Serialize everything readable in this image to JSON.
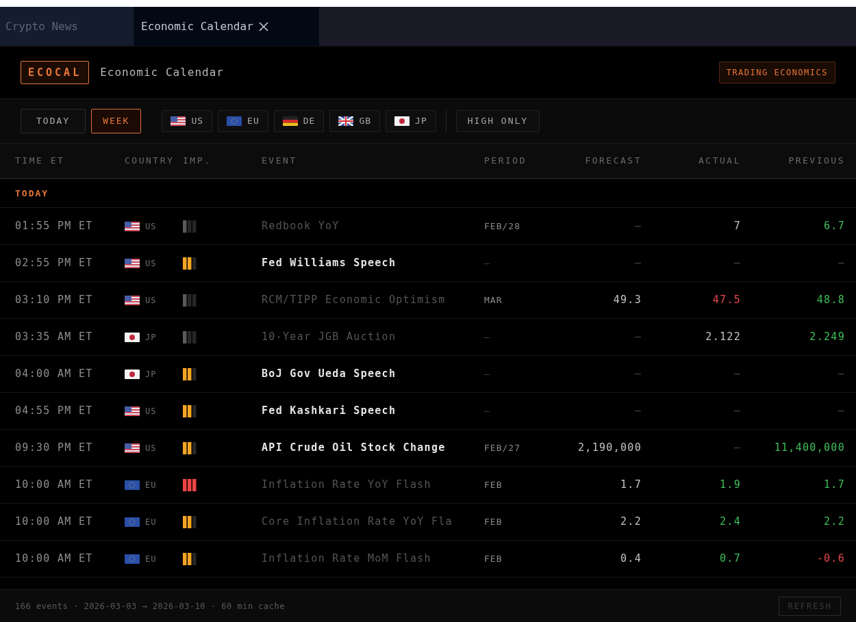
{
  "tabs": [
    {
      "label": "Crypto News",
      "selected": false
    },
    {
      "label": "Economic Calendar",
      "selected": true
    }
  ],
  "header": {
    "badge": "ECOCAL",
    "title": "Economic Calendar",
    "source": "TRADING ECONOMICS"
  },
  "range_buttons": [
    {
      "label": "TODAY",
      "selected": false
    },
    {
      "label": "WEEK",
      "selected": true
    }
  ],
  "country_filters": [
    {
      "kind": "us",
      "label": "US",
      "selected": false
    },
    {
      "kind": "eu",
      "label": "EU",
      "selected": false
    },
    {
      "kind": "de",
      "label": "DE",
      "selected": false
    },
    {
      "kind": "gb",
      "label": "GB",
      "selected": false
    },
    {
      "kind": "jp",
      "label": "JP",
      "selected": false
    }
  ],
  "high_only": {
    "label": "HIGH ONLY",
    "on": false
  },
  "columns": [
    "TIME ET",
    "COUNTRY",
    "IMP.",
    "EVENT",
    "PERIOD",
    "FORECAST",
    "ACTUAL",
    "PREVIOUS"
  ],
  "section": "TODAY",
  "rows": [
    {
      "time": "01:55 PM ET",
      "kind": "us",
      "country": "US",
      "importance": {
        "kind": "low"
      },
      "event": "Redbook YoY",
      "released": true,
      "period": {
        "text": "FEB/28",
        "color": "#8a8a8a"
      },
      "forecast": {
        "text": "—",
        "color": "#4a4a4a"
      },
      "actual": {
        "text": "7",
        "color": "#c4c4c4"
      },
      "previous": {
        "text": "6.7",
        "color": "#3fbf5a"
      }
    },
    {
      "time": "02:55 PM ET",
      "kind": "us",
      "country": "US",
      "importance": {
        "kind": "medium"
      },
      "event": "Fed Williams Speech",
      "released": false,
      "period": {
        "text": "—",
        "color": "#4a4a4a"
      },
      "forecast": {
        "text": "—",
        "color": "#4a4a4a"
      },
      "actual": {
        "text": "—",
        "color": "#4a4a4a"
      },
      "previous": {
        "text": "—",
        "color": "#4a4a4a"
      }
    },
    {
      "time": "03:10 PM ET",
      "kind": "us",
      "country": "US",
      "importance": {
        "kind": "low"
      },
      "event": "RCM/TIPP Economic Optimism",
      "released": true,
      "period": {
        "text": "MAR",
        "color": "#8a8a8a"
      },
      "forecast": {
        "text": "49.3",
        "color": "#c4c4c4"
      },
      "actual": {
        "text": "47.5",
        "color": "#e5484d"
      },
      "previous": {
        "text": "48.8",
        "color": "#3fbf5a"
      }
    },
    {
      "time": "03:35 AM ET",
      "kind": "jp",
      "country": "JP",
      "importance": {
        "kind": "low"
      },
      "event": "10-Year JGB Auction",
      "released": true,
      "period": {
        "text": "—",
        "color": "#4a4a4a"
      },
      "forecast": {
        "text": "—",
        "color": "#4a4a4a"
      },
      "actual": {
        "text": "2.122",
        "color": "#c4c4c4"
      },
      "previous": {
        "text": "2.249",
        "color": "#3fbf5a"
      }
    },
    {
      "time": "04:00 AM ET",
      "kind": "jp",
      "country": "JP",
      "importance": {
        "kind": "medium"
      },
      "event": "BoJ Gov Ueda Speech",
      "released": false,
      "period": {
        "text": "—",
        "color": "#4a4a4a"
      },
      "forecast": {
        "text": "—",
        "color": "#4a4a4a"
      },
      "actual": {
        "text": "—",
        "color": "#4a4a4a"
      },
      "previous": {
        "text": "—",
        "color": "#4a4a4a"
      }
    },
    {
      "time": "04:55 PM ET",
      "kind": "us",
      "country": "US",
      "importance": {
        "kind": "medium"
      },
      "event": "Fed Kashkari Speech",
      "released": false,
      "period": {
        "text": "—",
        "color": "#4a4a4a"
      },
      "forecast": {
        "text": "—",
        "color": "#4a4a4a"
      },
      "actual": {
        "text": "—",
        "color": "#4a4a4a"
      },
      "previous": {
        "text": "—",
        "color": "#4a4a4a"
      }
    },
    {
      "time": "09:30 PM ET",
      "kind": "us",
      "country": "US",
      "importance": {
        "kind": "medium"
      },
      "event": "API Crude Oil Stock Change",
      "released": false,
      "period": {
        "text": "FEB/27",
        "color": "#8a8a8a"
      },
      "forecast": {
        "text": "2,190,000",
        "color": "#c4c4c4"
      },
      "actual": {
        "text": "—",
        "color": "#4a4a4a"
      },
      "previous": {
        "text": "11,400,000",
        "color": "#3fbf5a"
      }
    },
    {
      "time": "10:00 AM ET",
      "kind": "eu",
      "country": "EU",
      "importance": {
        "kind": "high"
      },
      "event": "Inflation Rate YoY Flash",
      "released": true,
      "period": {
        "text": "FEB",
        "color": "#8a8a8a"
      },
      "forecast": {
        "text": "1.7",
        "color": "#c4c4c4"
      },
      "actual": {
        "text": "1.9",
        "color": "#3fbf5a"
      },
      "previous": {
        "text": "1.7",
        "color": "#3fbf5a"
      }
    },
    {
      "time": "10:00 AM ET",
      "kind": "eu",
      "country": "EU",
      "importance": {
        "kind": "medium"
      },
      "event": "Core Inflation Rate YoY Fla",
      "released": true,
      "period": {
        "text": "FEB",
        "color": "#8a8a8a"
      },
      "forecast": {
        "text": "2.2",
        "color": "#c4c4c4"
      },
      "actual": {
        "text": "2.4",
        "color": "#3fbf5a"
      },
      "previous": {
        "text": "2.2",
        "color": "#3fbf5a"
      }
    },
    {
      "time": "10:00 AM ET",
      "kind": "eu",
      "country": "EU",
      "importance": {
        "kind": "medium"
      },
      "event": "Inflation Rate MoM Flash",
      "released": true,
      "period": {
        "text": "FEB",
        "color": "#8a8a8a"
      },
      "forecast": {
        "text": "0.4",
        "color": "#c4c4c4"
      },
      "actual": {
        "text": "0.7",
        "color": "#3fbf5a"
      },
      "previous": {
        "text": "-0.6",
        "color": "#e5484d"
      }
    }
  ],
  "footer": {
    "status": "166 events · 2026-03-03 → 2026-03-10 · 60 min cache",
    "refresh": "REFRESH"
  }
}
